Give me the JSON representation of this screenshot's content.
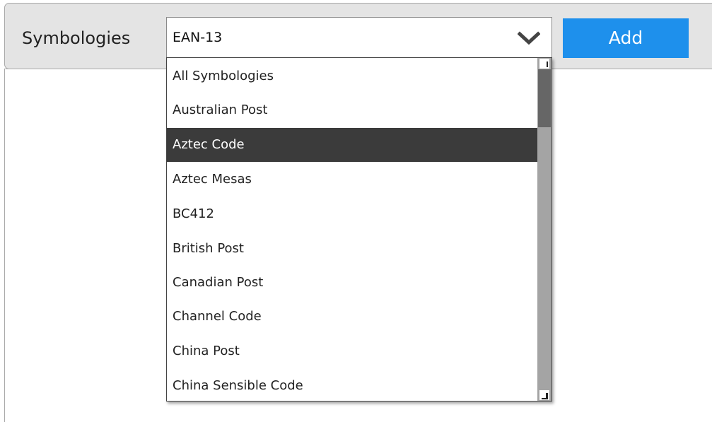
{
  "toolbar": {
    "label": "Symbologies",
    "select_value": "EAN-13",
    "add_label": "Add"
  },
  "dropdown": {
    "items": [
      {
        "label": "All Symbologies"
      },
      {
        "label": "Australian Post"
      },
      {
        "label": "Aztec Code"
      },
      {
        "label": "Aztec Mesas"
      },
      {
        "label": "BC412"
      },
      {
        "label": "British Post"
      },
      {
        "label": "Canadian Post"
      },
      {
        "label": "Channel Code"
      },
      {
        "label": "China Post"
      },
      {
        "label": "China Sensible Code"
      }
    ],
    "highlighted_index": 2
  },
  "icons": {
    "select_arrow": "chevron-down-icon",
    "scroll_up": "scroll-up-arrow-icon",
    "scroll_down": "scroll-down-arrow-icon"
  },
  "colors": {
    "button": "#1e90ec",
    "highlight": "#3b3b3b",
    "toolbar_bg": "#e4e4e4"
  }
}
